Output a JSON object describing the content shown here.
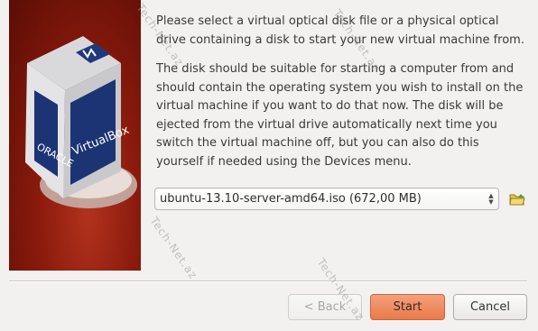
{
  "content": {
    "paragraph1": "Please select a virtual optical disk file or a physical optical drive containing a disk to start your new virtual machine from.",
    "paragraph2": "The disk should be suitable for starting a computer from and should contain the operating system you wish to install on the virtual machine if you want to do that now. The disk will be ejected from the virtual drive automatically next time you switch the virtual machine off, but you can also do this yourself if needed using the Devices menu."
  },
  "media_selector": {
    "value": "ubuntu-13.10-server-amd64.iso (672,00 MB)"
  },
  "logo": {
    "brand_text": "ORACLE",
    "product_text": "VirtualBox"
  },
  "buttons": {
    "back_label": "< Back",
    "start_label": "Start",
    "cancel_label": "Cancel"
  },
  "watermark": {
    "text": "Tech-Net.az"
  },
  "colors": {
    "start_accent": "#ea7a4c",
    "art_background": "#8a1a0c",
    "cube_blue": "#1f3a7a"
  },
  "icons": {
    "folder": "folder-open-icon",
    "combo": "spinner-arrows-icon"
  }
}
